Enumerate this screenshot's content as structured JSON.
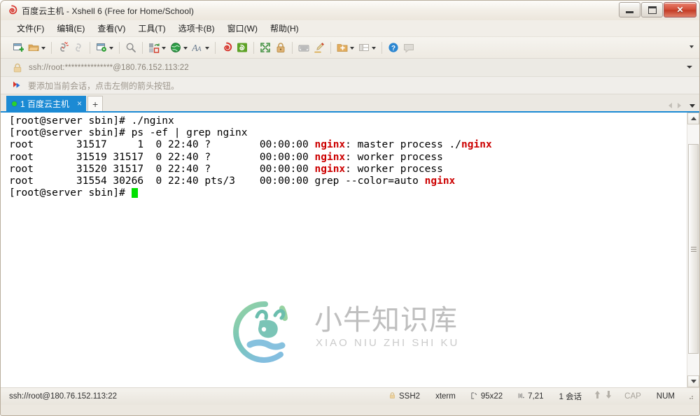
{
  "window": {
    "title": "百度云主机 - Xshell 6 (Free for Home/School)",
    "app_icon": "xshell-spiral-icon",
    "controls": {
      "minimize": "minimize-button",
      "maximize": "maximize-button",
      "close": "close-button",
      "close_glyph": "✕"
    }
  },
  "menubar": {
    "items": [
      {
        "label": "文件(F)",
        "name": "menu-file"
      },
      {
        "label": "编辑(E)",
        "name": "menu-edit"
      },
      {
        "label": "查看(V)",
        "name": "menu-view"
      },
      {
        "label": "工具(T)",
        "name": "menu-tools"
      },
      {
        "label": "选项卡(B)",
        "name": "menu-tabs"
      },
      {
        "label": "窗口(W)",
        "name": "menu-window"
      },
      {
        "label": "帮助(H)",
        "name": "menu-help"
      }
    ]
  },
  "toolbar": {
    "overflow_icon": "chevron-down-icon",
    "items": [
      {
        "name": "new-session-icon",
        "caret": false
      },
      {
        "name": "open-folder-icon",
        "caret": true
      },
      {
        "sep": true
      },
      {
        "name": "disconnect-icon",
        "caret": false
      },
      {
        "name": "reconnect-link-icon",
        "caret": false
      },
      {
        "sep": true
      },
      {
        "name": "session-properties-icon",
        "caret": true
      },
      {
        "sep": true
      },
      {
        "name": "find-icon",
        "caret": false
      },
      {
        "sep": true
      },
      {
        "name": "transfer-file-icon",
        "caret": true
      },
      {
        "name": "globe-icon",
        "caret": true
      },
      {
        "name": "font-size-icon",
        "caret": true
      },
      {
        "sep": true
      },
      {
        "name": "xshell-spiral-icon",
        "caret": false
      },
      {
        "name": "xftp-icon",
        "caret": false
      },
      {
        "sep": true
      },
      {
        "name": "fullscreen-icon",
        "caret": false
      },
      {
        "name": "lock-icon",
        "caret": false
      },
      {
        "sep": true
      },
      {
        "name": "keyboard-icon",
        "caret": false
      },
      {
        "name": "highlight-pen-icon",
        "caret": false
      },
      {
        "sep": true
      },
      {
        "name": "add-to-folder-icon",
        "caret": true
      },
      {
        "name": "split-layout-icon",
        "caret": true
      },
      {
        "sep": true
      },
      {
        "name": "help-icon",
        "caret": false
      },
      {
        "name": "comment-icon",
        "caret": false
      }
    ]
  },
  "address_bar": {
    "lock_icon": "lock-icon",
    "value": "ssh://root:***************@180.76.152.113:22",
    "dropdown_icon": "chevron-down-icon"
  },
  "hint_bar": {
    "icon": "arrow-flag-icon",
    "text": "要添加当前会话，点击左侧的箭头按钮。"
  },
  "tabbar": {
    "tabs": [
      {
        "status_dot": "connected-dot",
        "label": "1 百度云主机",
        "close_glyph": "×",
        "active": true
      }
    ],
    "new_tab_glyph": "+",
    "nav_prev_icon": "chevron-left-icon",
    "nav_next_icon": "chevron-right-icon",
    "nav_list_icon": "chevron-down-icon"
  },
  "terminal": {
    "background": "#ffffff",
    "foreground": "#000000",
    "highlight_color": "#cc0000",
    "cursor_color": "#00e000",
    "lines": [
      {
        "segments": [
          {
            "t": "[root@server sbin]# ./nginx"
          }
        ]
      },
      {
        "segments": [
          {
            "t": "[root@server sbin]# ps -ef | grep nginx"
          }
        ]
      },
      {
        "segments": [
          {
            "t": "root       31517     1  0 22:40 ?        00:00:00 "
          },
          {
            "t": "nginx",
            "hl": true
          },
          {
            "t": ": master process ./"
          },
          {
            "t": "nginx",
            "hl": true
          }
        ]
      },
      {
        "segments": [
          {
            "t": "root       31519 31517  0 22:40 ?        00:00:00 "
          },
          {
            "t": "nginx",
            "hl": true
          },
          {
            "t": ": worker process"
          }
        ]
      },
      {
        "segments": [
          {
            "t": "root       31520 31517  0 22:40 ?        00:00:00 "
          },
          {
            "t": "nginx",
            "hl": true
          },
          {
            "t": ": worker process"
          }
        ]
      },
      {
        "segments": [
          {
            "t": "root       31554 30266  0 22:40 pts/3    00:00:00 grep --color=auto "
          },
          {
            "t": "nginx",
            "hl": true
          }
        ]
      },
      {
        "segments": [
          {
            "t": "[root@server sbin]# "
          },
          {
            "cursor": true
          }
        ]
      }
    ]
  },
  "watermark": {
    "logo_name": "xiaoniu-bull-logo",
    "title": "小牛知识库",
    "subtitle": "XIAO NIU ZHI SHI KU"
  },
  "scrollbar": {
    "up_icon": "scroll-up-arrow",
    "down_icon": "scroll-down-arrow"
  },
  "statusbar": {
    "url": "ssh://root@180.76.152.113:22",
    "protocol_icon": "lock-icon",
    "protocol": "SSH2",
    "terminal_type": "xterm",
    "size_icon": "terminal-size-icon",
    "size": "95x22",
    "cursor_icon": "cursor-position-icon",
    "cursor_position": "7,21",
    "sessions": "1 会话",
    "upload_icon": "upload-arrow-icon",
    "download_icon": "download-arrow-icon",
    "caps_lock": "CAP",
    "num_lock": "NUM",
    "resize_grip": "resize-grip-icon"
  }
}
